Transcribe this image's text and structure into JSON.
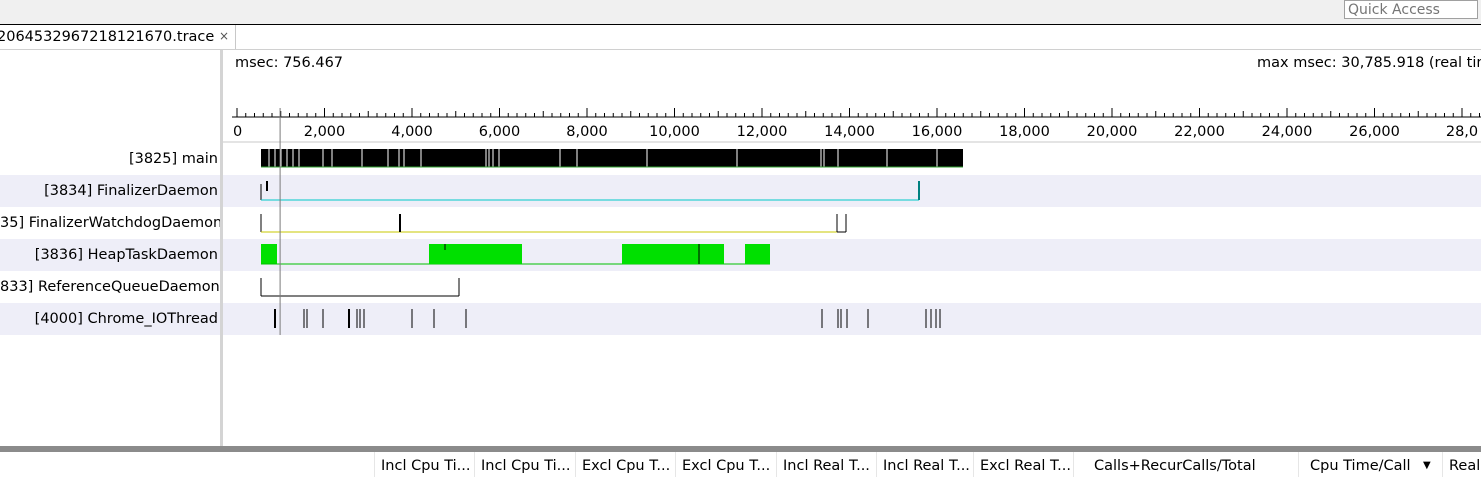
{
  "toolbar": {
    "quick_access_placeholder": "Quick Access"
  },
  "tab": {
    "label": "2064532967218121670.trace",
    "close_glyph": "×"
  },
  "timeline": {
    "msec_label": "msec: 756.467",
    "max_label": "max msec: 30,785.918 (real tim",
    "ticks": [
      "0",
      "2,000",
      "4,000",
      "6,000",
      "8,000",
      "10,000",
      "12,000",
      "14,000",
      "16,000",
      "18,000",
      "20,000",
      "22,000",
      "24,000",
      "26,000",
      "28,0"
    ],
    "tick_values": [
      0,
      2000,
      4000,
      6000,
      8000,
      10000,
      12000,
      14000,
      16000,
      18000,
      20000,
      22000,
      24000,
      26000,
      28000
    ],
    "cursor_msec": 756.467
  },
  "threads": [
    {
      "label": "[3825] main",
      "color": "#000000"
    },
    {
      "label": "[3834] FinalizerDaemon",
      "color": "#00c8c8"
    },
    {
      "label": "35] FinalizerWatchdogDaemon",
      "color": "#c8c800"
    },
    {
      "label": "[3836] HeapTaskDaemon",
      "color": "#00e000"
    },
    {
      "label": "833] ReferenceQueueDaemon",
      "color": "#000000"
    },
    {
      "label": "[4000] Chrome_IOThread",
      "color": "#000000"
    }
  ],
  "columns": [
    {
      "label": "Incl Cpu Ti..."
    },
    {
      "label": "Incl Cpu Ti..."
    },
    {
      "label": "Excl Cpu T..."
    },
    {
      "label": "Excl Cpu T..."
    },
    {
      "label": "Incl Real T..."
    },
    {
      "label": "Incl Real T..."
    },
    {
      "label": "Excl Real T..."
    },
    {
      "label": "Calls+RecurCalls/Total"
    },
    {
      "label": "Cpu Time/Call"
    },
    {
      "label": "Real"
    }
  ],
  "sort_glyph": "▼"
}
